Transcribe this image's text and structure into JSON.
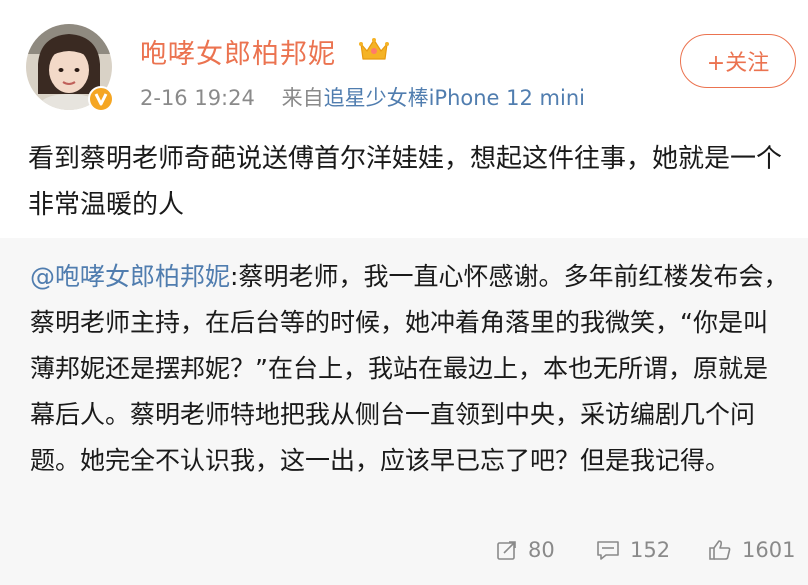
{
  "user": {
    "name": "咆哮女郎柏邦妮",
    "crown_icon": "crown-icon",
    "verified_icon": "verified-badge-icon"
  },
  "meta": {
    "date": "2-16 19:24",
    "source_prefix": "来自",
    "client": "追星少女棒iPhone 12 mini"
  },
  "follow_button": {
    "label": "+关注"
  },
  "post": {
    "text": "看到蔡明老师奇葩说送傅首尔洋娃娃，想起这件往事，她就是一个非常温暖的人"
  },
  "repost": {
    "mention": "@咆哮女郎柏邦妮",
    "text": ":蔡明老师，我一直心怀感谢。多年前红楼发布会，蔡明老师主持，在后台等的时候，她冲着角落里的我微笑，“你是叫薄邦妮还是摆邦妮？”在台上，我站在最边上，本也无所谓，原就是幕后人。蔡明老师特地把我从侧台一直领到中央，采访编剧几个问题。她完全不认识我，这一出，应该早已忘了吧？但是我记得。"
  },
  "actions": {
    "repost_count": "80",
    "comment_count": "152",
    "like_count": "1601"
  },
  "colors": {
    "accent": "#eb7350",
    "link": "#507daf",
    "muted": "#8a8a8a",
    "repost_bg": "#f7f7f7"
  }
}
